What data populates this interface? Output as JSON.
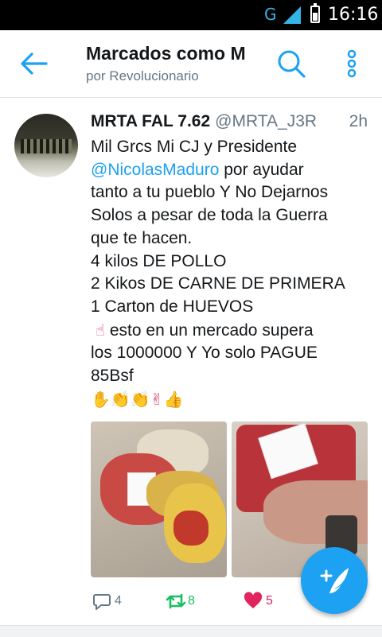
{
  "status_bar": {
    "network": "G",
    "time": "16:16"
  },
  "app_bar": {
    "title": "Marcados como M",
    "subtitle": "por Revolucionario"
  },
  "tweet": {
    "name": "MRTA FAL 7.62",
    "handle": "@MRTA_J3R",
    "time_ago": "2h",
    "lines": {
      "l1": "Mil Grcs Mi CJ y Presidente",
      "mention": "@NicolasMaduro",
      "l2_rest": " por ayudar",
      "l3": "tanto a tu pueblo Y No Dejarnos",
      "l4": "Solos a pesar de toda la Guerra",
      "l5": "que te hacen.",
      "l6": "4 kilos DE POLLO",
      "l7": "2 Kikos DE CARNE DE PRIMERA",
      "l8": "1 Carton de HUEVOS",
      "l9_emoji": "☝",
      "l9": " esto en un mercado supera",
      "l10": "los 1000000 Y Yo solo PAGUE",
      "l11": "85Bsf",
      "emoji_row": "✋👏👏✌👍"
    },
    "reply_count": "4",
    "retweet_count": "8",
    "like_count": "5"
  },
  "icons": {
    "back": "arrow-left-icon",
    "search": "search-icon",
    "more": "more-vertical-icon",
    "reply": "reply-icon",
    "retweet": "retweet-icon",
    "like": "heart-icon",
    "compose": "compose-icon"
  },
  "colors": {
    "accent": "#1da1f2",
    "retweet": "#17bf63",
    "like": "#e0245e",
    "text": "#14171a",
    "muted": "#657786"
  }
}
